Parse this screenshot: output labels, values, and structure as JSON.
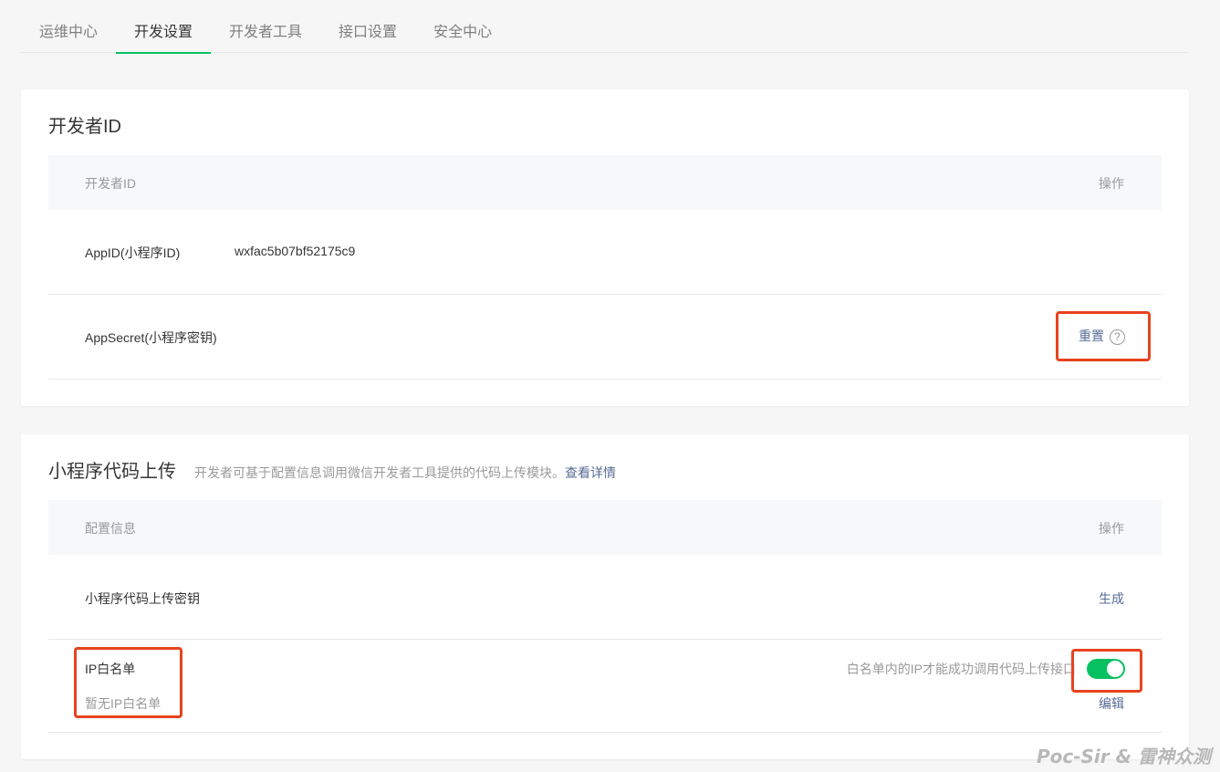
{
  "tabs": [
    {
      "label": "运维中心",
      "active": false
    },
    {
      "label": "开发设置",
      "active": true
    },
    {
      "label": "开发者工具",
      "active": false
    },
    {
      "label": "接口设置",
      "active": false
    },
    {
      "label": "安全中心",
      "active": false
    }
  ],
  "dev_id_section": {
    "title": "开发者ID",
    "header_left": "开发者ID",
    "header_right": "操作",
    "appid_label": "AppID(小程序ID)",
    "appid_value": "wxfac5b07bf52175c9",
    "appsecret_label": "AppSecret(小程序密钥)",
    "reset_label": "重置",
    "help_icon": "?"
  },
  "upload_section": {
    "title": "小程序代码上传",
    "desc": "开发者可基于配置信息调用微信开发者工具提供的代码上传模块。",
    "desc_link": "查看详情",
    "header_left": "配置信息",
    "header_right": "操作",
    "key_label": "小程序代码上传密钥",
    "generate_label": "生成",
    "whitelist_label": "IP白名单",
    "whitelist_empty": "暂无IP白名单",
    "whitelist_hint": "白名单内的IP才能成功调用代码上传接口",
    "whitelist_enabled": true,
    "edit_label": "编辑"
  },
  "watermark": "Poc-Sir & 雷神众测",
  "colors": {
    "accent": "#07c160",
    "link": "#576b95",
    "highlight": "#e8431e"
  }
}
